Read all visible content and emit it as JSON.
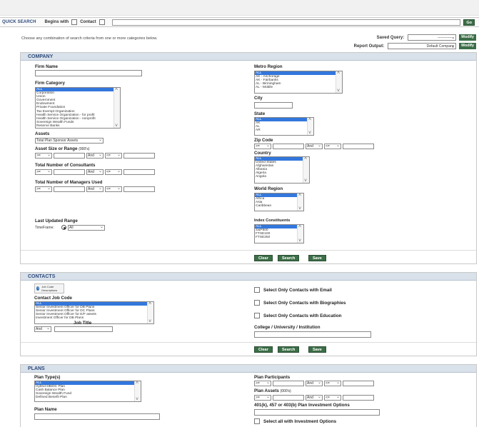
{
  "quick_search": {
    "label": "QUICK SEARCH",
    "begins_with": "Begins with",
    "contact": "Contact",
    "go": "Go"
  },
  "intro": "Choose any combination of search criteria from one or more categories below.",
  "saved_query": {
    "label": "Saved Query:",
    "value": "--------------",
    "modify": "Modify"
  },
  "report_output": {
    "label": "Report Output:",
    "value": "Default Company",
    "modify": "Modify"
  },
  "company": {
    "title": "COMPANY",
    "firm_name": "Firm Name",
    "firm_category": "Firm Category",
    "firm_category_options": [
      "ALL",
      "Corporation",
      "Union",
      "Government",
      "Endowment",
      "Private Foundation",
      "Tax Exempt Organization",
      "Health Service Organization - for profit",
      "Health Service Organization - nonprofit",
      "Sovereign Wealth Funds",
      "Reserve Banks"
    ],
    "assets": "Assets",
    "assets_value": "Total Plan Sponsor Assets",
    "asset_size": "Asset Size or Range",
    "asset_size_unit": "(000's)",
    "op_ge": ">=",
    "op_and": "And",
    "op_le": "<=",
    "consultants": "Total Number of Consultants",
    "managers": "Total Number of Managers Used",
    "last_updated": "Last Updated Range",
    "timeframe": "TimeFrame:",
    "timeframe_value": "All",
    "metro": "Metro Region",
    "metro_options": [
      "ALL",
      "AK - Anchorage",
      "AK - Fairbanks",
      "AL - Birmingham",
      "AL - Mobile"
    ],
    "city": "City",
    "state": "State",
    "state_options": [
      "ALL",
      "AK",
      "AL",
      "AR"
    ],
    "zip": "Zip Code",
    "country": "Country",
    "country_options": [
      "ALL",
      "United States",
      "Afghanistan",
      "Albania",
      "Algeria",
      "Angola"
    ],
    "world": "World Region",
    "world_options": [
      "ALL",
      "Africa",
      "Asia",
      "Caribbean"
    ],
    "index": "Index Constituents",
    "index_options": [
      "ALL",
      "S&P500",
      "FTSE100",
      "FTSE250"
    ],
    "clear": "Clear",
    "search": "Search",
    "save": "Save"
  },
  "contacts": {
    "title": "CONTACTS",
    "info": "Job Code Descriptions",
    "job_code": "Contact Job Code",
    "job_code_options": [
      "ALL",
      "Senior Investment Officer for DB Plans",
      "Senior Investment Officer for DC Plans",
      "Senior Investment Officer for E/F assets",
      "Investment Officer for DB Plans"
    ],
    "job_title": "Job Title",
    "op_and": "And",
    "email": "Select Only Contacts with Email",
    "bios": "Select Only Contacts with Biographies",
    "education": "Select Only Contacts with Education",
    "college": "College / University / Institution",
    "clear": "Clear",
    "search": "Search",
    "save": "Save"
  },
  "plans": {
    "title": "PLANS",
    "plan_types": "Plan Type(s)",
    "plan_type_options": [
      "ALL",
      "Hybrid DB/DC Plan",
      "Cash Balance Plan",
      "Sovereign Wealth Fund",
      "Defined Benefit Plan"
    ],
    "plan_name": "Plan Name",
    "participants": "Plan Participants",
    "plan_assets": "Plan Assets",
    "plan_assets_unit": "(000's)",
    "options_label": "401(k), 457 or 403(b) Plan Investment Options",
    "select_all": "Select all with Investment Options",
    "op_ge": ">=",
    "op_and": "And",
    "op_le": "<="
  }
}
